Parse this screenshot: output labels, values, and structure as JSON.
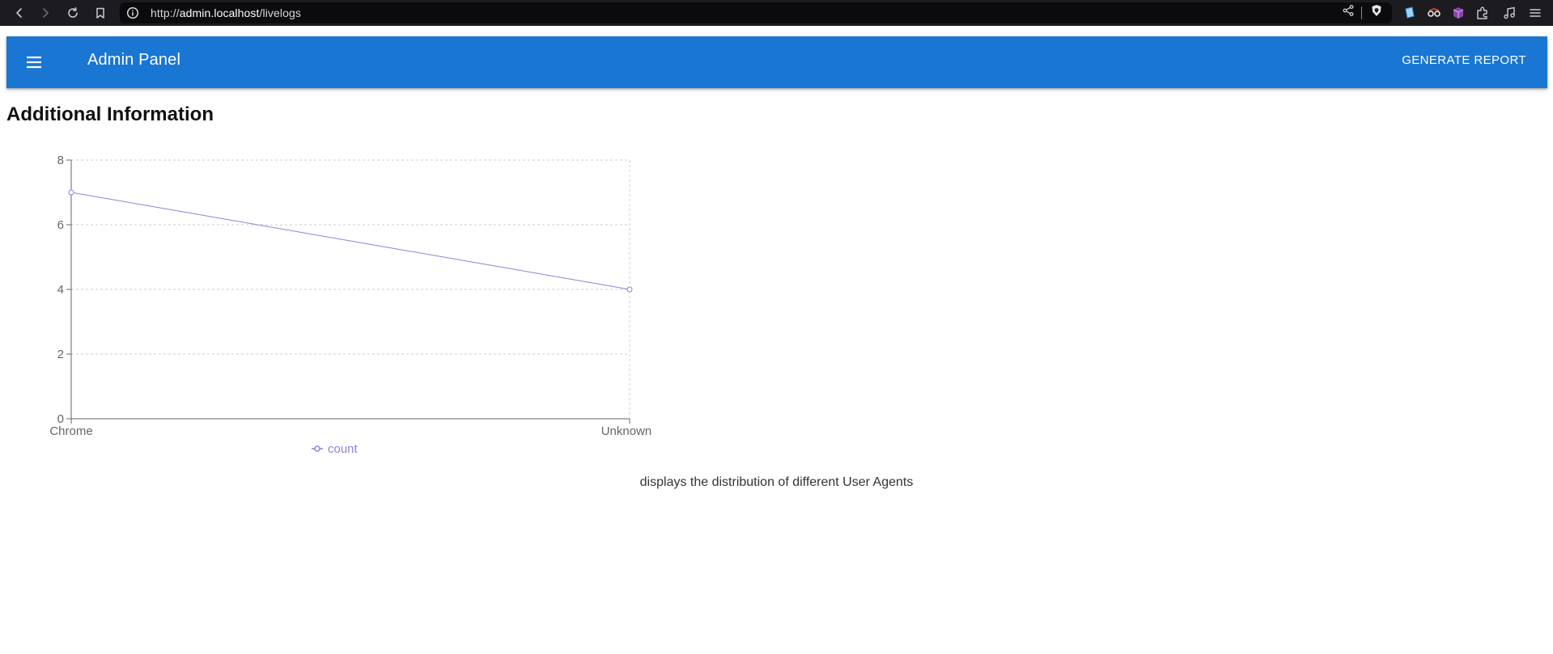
{
  "browser": {
    "url_scheme": "http://",
    "url_host": "admin.localhost",
    "url_path": "/livelogs"
  },
  "app_bar": {
    "title": "Admin Panel",
    "report_label": "GENERATE REPORT",
    "color": "#1976d2"
  },
  "section_title": "Additional Information",
  "caption": "displays the distribution of different User Agents",
  "chart_data": {
    "type": "line",
    "categories": [
      "Chrome",
      "Unknown"
    ],
    "series": [
      {
        "name": "count",
        "values": [
          7,
          4
        ],
        "color": "#8884d8"
      }
    ],
    "ylim": [
      0,
      8
    ],
    "yticks": [
      0,
      2,
      4,
      6,
      8
    ],
    "grid": true,
    "legend": "bottom-center"
  }
}
